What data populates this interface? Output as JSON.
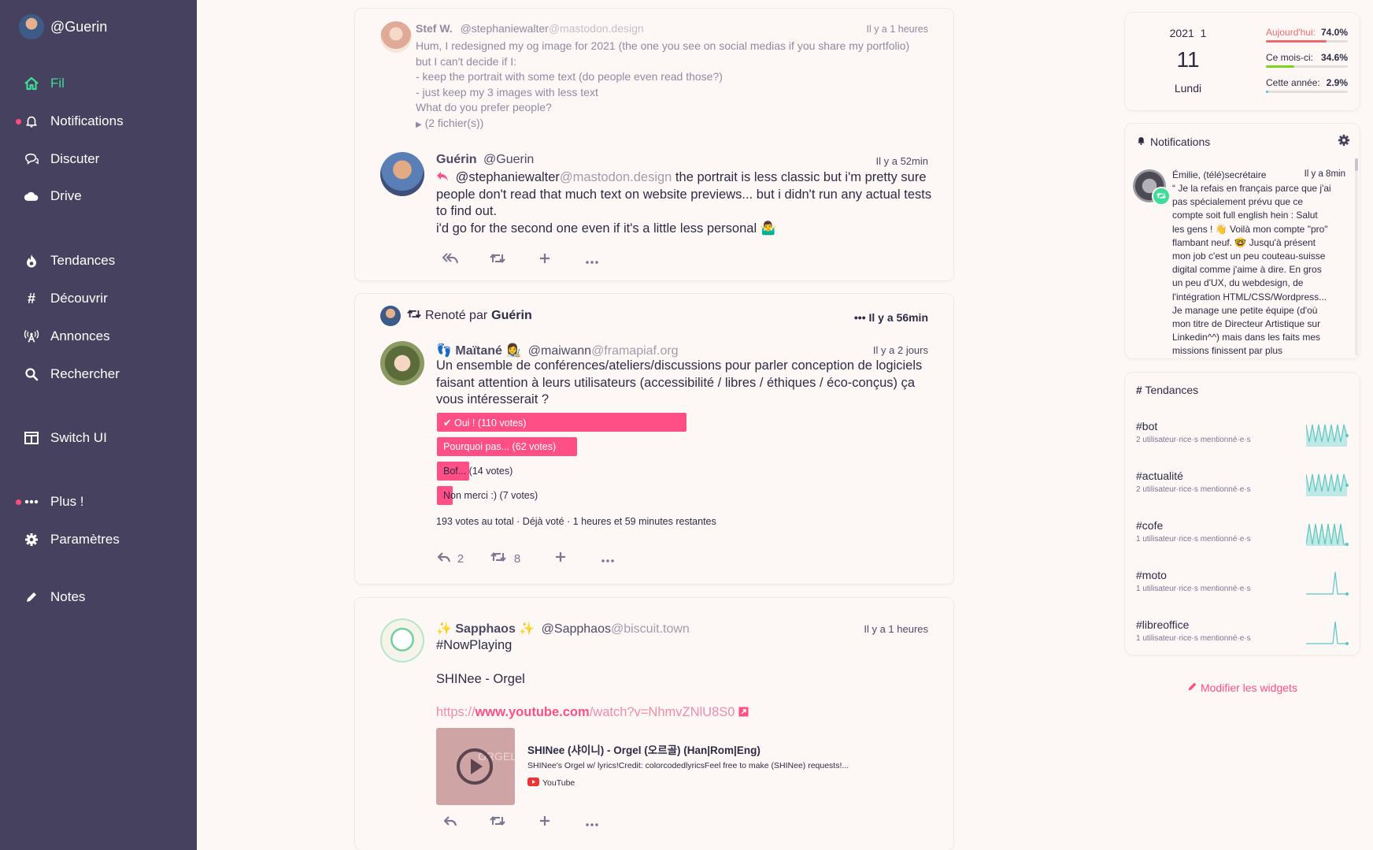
{
  "sidebar": {
    "user": "@Guerin",
    "items": [
      {
        "label": "Fil",
        "icon": "home-icon"
      },
      {
        "label": "Notifications",
        "icon": "bell-icon"
      },
      {
        "label": "Discuter",
        "icon": "chat-icon"
      },
      {
        "label": "Drive",
        "icon": "cloud-icon"
      },
      {
        "label": "Tendances",
        "icon": "flame-icon"
      },
      {
        "label": "Découvrir",
        "icon": "hash-icon"
      },
      {
        "label": "Annonces",
        "icon": "broadcast-icon"
      },
      {
        "label": "Rechercher",
        "icon": "search-icon"
      },
      {
        "label": "Switch UI",
        "icon": "columns-icon"
      },
      {
        "label": "Plus !",
        "icon": "dots-icon"
      },
      {
        "label": "Paramètres",
        "icon": "gear-icon"
      },
      {
        "label": "Notes",
        "icon": "pencil-icon"
      }
    ]
  },
  "feed": {
    "post1": {
      "name": "Stef W.",
      "handle": "@stephaniewalter",
      "domain": "@mastodon.design",
      "time": "Il y a 1 heures",
      "lines": [
        "Hum, I redesigned my og image for 2021 (the one you see on social medias if you share my portfolio)",
        "but I can't decide if I:",
        "- keep the portrait with some text (do people even read those?)",
        "- just keep my 3 images with less text",
        "What do you prefer people?"
      ],
      "files": "(2 fichier(s))"
    },
    "reply1": {
      "name": "Guérin",
      "handle": "@Guerin",
      "time": "Il y a 52min",
      "mention": "@stephaniewalter",
      "mention_domain": "@mastodon.design",
      "text1": " the portrait is less classic but i'm pretty sure",
      "text2": "people don't read that much text on website previews... but i didn't run any actual tests",
      "text3": "to find out.",
      "text4": "i'd go for the second one even if it's a little less personal 🤷‍♂️"
    },
    "post2": {
      "boost_prefix": "Renoté par",
      "booster": "Guérin",
      "boost_time": "Il y a 56min",
      "name": "Maïtané",
      "handle": "@maiwann",
      "domain": "@framapiaf.org",
      "time": "Il y a 2 jours",
      "lines": [
        "Un ensemble de conférences/ateliers/discussions pour parler conception de logiciels",
        "faisant attention à leurs utilisateurs (accessibilité / libres / éthiques / éco-conçus) ça",
        "vous intéresserait ?"
      ],
      "poll": [
        {
          "label": "Oui ! (110 votes)",
          "fraction": 0.57,
          "voted": true
        },
        {
          "label": "Pourquoi pas... (62 votes)",
          "fraction": 0.32,
          "voted": false
        },
        {
          "label": "Bof... (14 votes)",
          "fraction": 0.073,
          "voted": false
        },
        {
          "label": "Non merci :) (7 votes)",
          "fraction": 0.036,
          "voted": false
        }
      ],
      "poll_summary": "193 votes au total · Déjà voté · 1 heures et 59 minutes restantes",
      "replies": "2",
      "boosts": "8"
    },
    "post3": {
      "name": "Sapphaos",
      "handle": "@Sapphaos",
      "domain": "@biscuit.town",
      "time": "Il y a 1 heures",
      "line1": "#NowPlaying",
      "line2": "SHINee - Orgel",
      "url_scheme": "https://",
      "url_host": "www.youtube.com",
      "url_path": "/watch",
      "url_query": "?v=NhmvZNlU8S0",
      "card_title": "SHINee (샤이니) - Orgel (오르골) (Han|Rom|Eng)",
      "card_desc": "SHINee's Orgel w/ lyrics!Credit: colorcodedlyricsFeel free to make (SHINee) requests!...",
      "card_source": "YouTube",
      "thumb_text": "ORGEL"
    }
  },
  "widgets": {
    "date": {
      "year": "2021",
      "month": "1",
      "day": "11",
      "weekday": "Lundi"
    },
    "stats": [
      {
        "label": "Aujourd'hui:",
        "value": "74.0%",
        "fraction": 0.74,
        "color": "#ef6b6b"
      },
      {
        "label": "Ce mois-ci:",
        "value": "34.6%",
        "fraction": 0.346,
        "color": "#7ed321"
      },
      {
        "label": "Cette année:",
        "value": "2.9%",
        "fraction": 0.029,
        "color": "#4ec3e0"
      }
    ],
    "notifications": {
      "title": "Notifications",
      "author": "Émilie, (télé)secrétaire",
      "time": "Il y a 8min",
      "lines": [
        "“ Je la refais en français parce que j'ai",
        "pas spécialement prévu que ce",
        "compte soit full english hein : Salut",
        "les gens ! 👋 Voilà mon compte \"pro\"",
        "flambant neuf. 🤓 Jusqu'à présent",
        "mon job c'est un peu couteau-suisse",
        "digital comme j'aime à dire. En gros",
        "un peu d'UX, du webdesign, de",
        "l'intégration HTML/CSS/Wordpress...",
        "Je manage une petite équipe (d'où",
        "mon titre de Directeur Artistique sur",
        "Linkedin^^) mais dans les faits mes",
        "missions finissent par plus"
      ]
    },
    "trends": {
      "title": "Tendances",
      "items": [
        {
          "tag": "#bot",
          "sub": "2 utilisateur·rice·s mentionné·e·s"
        },
        {
          "tag": "#actualité",
          "sub": "2 utilisateur·rice·s mentionné·e·s"
        },
        {
          "tag": "#cofe",
          "sub": "1 utilisateur·rice·s mentionné·e·s"
        },
        {
          "tag": "#moto",
          "sub": "1 utilisateur·rice·s mentionné·e·s"
        },
        {
          "tag": "#libreoffice",
          "sub": "1 utilisateur·rice·s mentionné·e·s"
        }
      ]
    },
    "edit_label": "Modifier les widgets"
  },
  "colors": {
    "sidebar": "#45415e",
    "accent": "#ff4f86",
    "active": "#3ddc97",
    "trend": "#5cc6c0"
  }
}
